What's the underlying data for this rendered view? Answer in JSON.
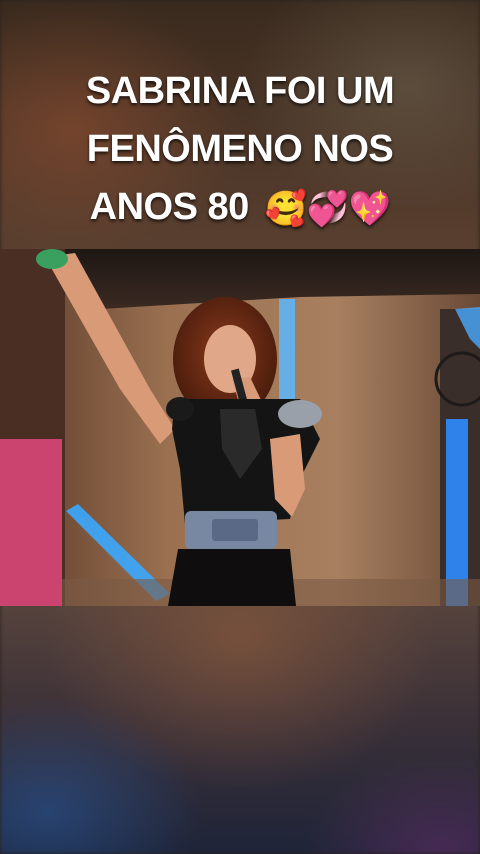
{
  "caption": {
    "line1": "SABRINA FOI UM",
    "line2": "FENÔMENO NOS",
    "line3": "ANOS 80",
    "emojis": "🥰💞💖"
  },
  "video": {
    "description_icon": "performer-video-frame"
  },
  "colors": {
    "caption_text": "#ffffff",
    "stage_light_blue": "#3aa8ff",
    "stage_light_pink": "#ff3c8c"
  }
}
